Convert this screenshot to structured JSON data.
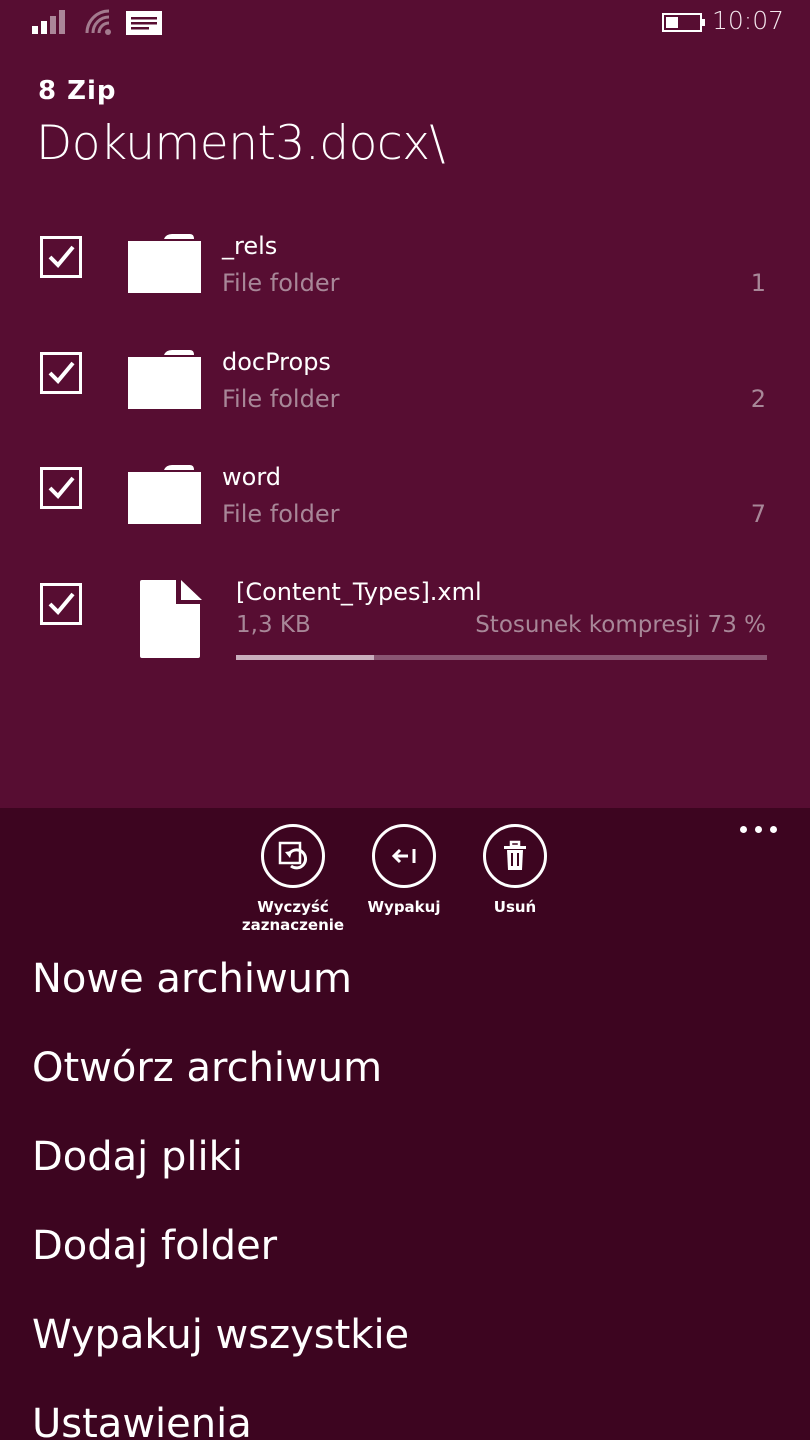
{
  "status_bar": {
    "time": "10:07"
  },
  "header": {
    "app_name": "8 Zip",
    "archive_title": "Dokument3.docx\\"
  },
  "items": [
    {
      "name": "_rels",
      "type": "File folder",
      "count": "1",
      "checked": true
    },
    {
      "name": "docProps",
      "type": "File folder",
      "count": "2",
      "checked": true
    },
    {
      "name": "word",
      "type": "File folder",
      "count": "7",
      "checked": true
    },
    {
      "name": "[Content_Types].xml",
      "size": "1,3 KB",
      "ratio": "Stosunek kompresji 73 %",
      "progress": 0.26,
      "checked": true
    }
  ],
  "app_bar": {
    "buttons": [
      {
        "label": "Wyczyść\nzaznaczenie",
        "icon": "clear-selection-icon"
      },
      {
        "label": "Wypakuj",
        "icon": "extract-icon"
      },
      {
        "label": "Usuń",
        "icon": "trash-icon"
      }
    ],
    "more_icon": "ellipsis-icon"
  },
  "menu": [
    "Nowe archiwum",
    "Otwórz archiwum",
    "Dodaj pliki",
    "Dodaj folder",
    "Wypakuj wszystkie",
    "Ustawienia"
  ],
  "colors": {
    "top_background": "#570d32",
    "bottom_background": "#3d0520",
    "secondary_text": "#a88798"
  }
}
